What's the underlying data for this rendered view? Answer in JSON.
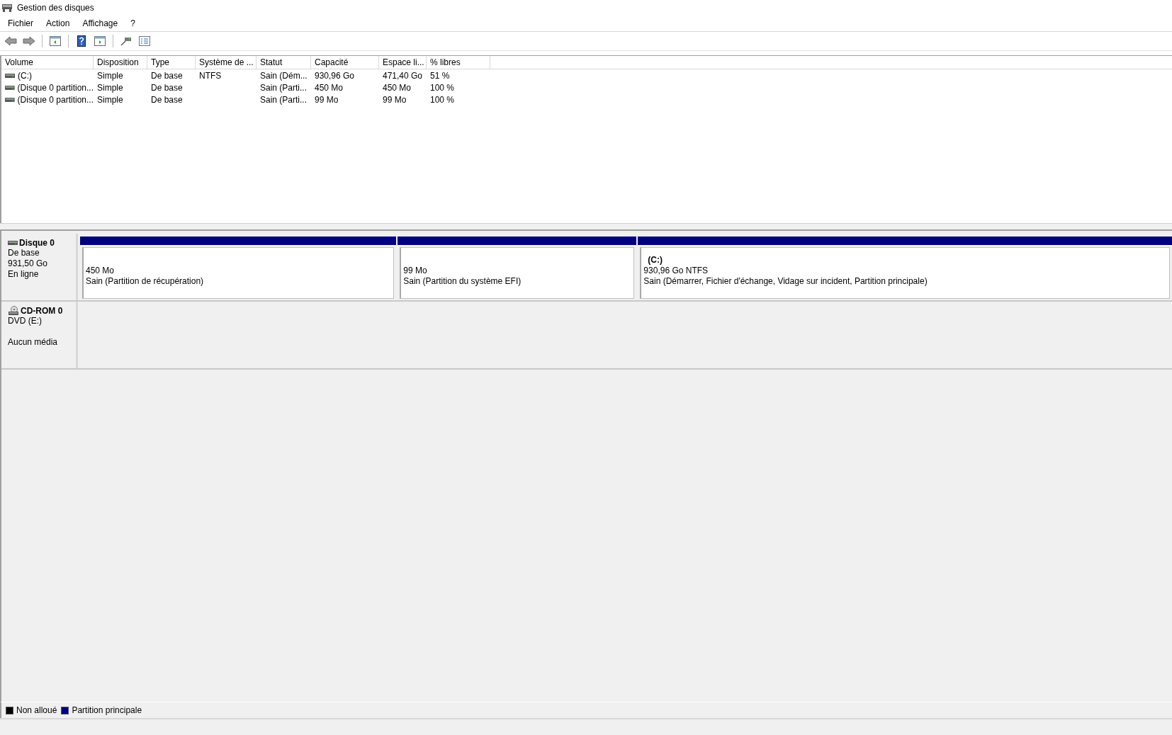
{
  "window": {
    "title": "Gestion des disques"
  },
  "menu": [
    "Fichier",
    "Action",
    "Affichage",
    "?"
  ],
  "toolbar": [
    {
      "kind": "back",
      "disabled": false
    },
    {
      "kind": "forward",
      "disabled": false
    },
    {
      "kind": "pane",
      "disabled": false
    },
    {
      "kind": "help",
      "disabled": false
    },
    {
      "kind": "pane2",
      "disabled": false
    },
    {
      "kind": "connect",
      "disabled": false
    },
    {
      "kind": "list",
      "disabled": false
    }
  ],
  "table": {
    "columns": [
      "Volume",
      "Disposition",
      "Type",
      "Système de ...",
      "Statut",
      "Capacité",
      "Espace li...",
      "% libres"
    ],
    "rows": [
      [
        "(C:)",
        "Simple",
        "De base",
        "NTFS",
        "Sain (Dém...",
        "930,96 Go",
        "471,40 Go",
        "51 %"
      ],
      [
        "(Disque 0 partition...",
        "Simple",
        "De base",
        "",
        "Sain (Parti...",
        "450 Mo",
        "450 Mo",
        "100 %"
      ],
      [
        "(Disque 0 partition...",
        "Simple",
        "De base",
        "",
        "Sain (Parti...",
        "99 Mo",
        "99 Mo",
        "100 %"
      ]
    ]
  },
  "disks": [
    {
      "kind": "disk",
      "name": "Disque 0",
      "lines": [
        "De base",
        "931,50 Go",
        "En ligne"
      ],
      "partitions": [
        {
          "size": "450 Mo",
          "status": "Sain (Partition de récupération)",
          "color": "#000080"
        },
        {
          "size": "99 Mo",
          "status": "Sain (Partition du système EFI)",
          "color": "#000080"
        },
        {
          "label": "(C:)",
          "size": "930,96 Go NTFS",
          "status": "Sain (Démarrer, Fichier d'échange, Vidage sur incident, Partition principale)",
          "color": "#000080"
        }
      ]
    },
    {
      "kind": "cdrom",
      "name": "CD-ROM 0",
      "lines": [
        "DVD (E:)",
        "Aucun média"
      ]
    }
  ],
  "legend": [
    {
      "label": "Non alloué",
      "color": "#000000"
    },
    {
      "label": "Partition principale",
      "color": "#000080"
    }
  ]
}
